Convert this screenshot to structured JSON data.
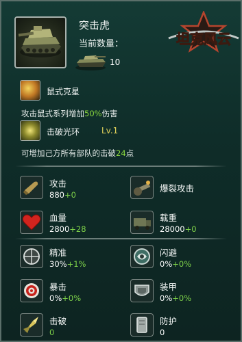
{
  "tank": {
    "name": "突击虎",
    "count_label": "当前数量：",
    "count": "10"
  },
  "logo": {
    "text": "坦克风云"
  },
  "skills": [
    {
      "name": "鼠式克星",
      "desc_prefix": "攻击鼠式系列增加",
      "desc_value": "50%",
      "desc_suffix": "伤害"
    },
    {
      "name": "击破光环",
      "level": "Lv.1",
      "desc_prefix": "可增加己方所有部队的击破",
      "desc_value": "24",
      "desc_suffix": "点"
    }
  ],
  "stats_primary": [
    {
      "label": "攻击",
      "base": "880",
      "bonus": "+0",
      "icon": "shell-icon"
    },
    {
      "label": "爆裂攻击",
      "base": "",
      "bonus": "",
      "icon": "cannon-icon"
    },
    {
      "label": "血量",
      "base": "2800",
      "bonus": "+28",
      "icon": "heart-icon"
    },
    {
      "label": "载重",
      "base": "28000",
      "bonus": "+0",
      "icon": "truck-icon"
    }
  ],
  "stats_secondary": [
    {
      "label": "精准",
      "base": "30%",
      "bonus": "+1%",
      "icon": "crosshair-icon"
    },
    {
      "label": "闪避",
      "base": "0%",
      "bonus": "+0%",
      "icon": "dodge-icon"
    },
    {
      "label": "暴击",
      "base": "0%",
      "bonus": "+0%",
      "icon": "target-icon"
    },
    {
      "label": "装甲",
      "base": "0%",
      "bonus": "+0%",
      "icon": "armor-icon"
    },
    {
      "label": "击破",
      "base": "0",
      "bonus": "",
      "icon": "breach-icon"
    },
    {
      "label": "防护",
      "base": "0",
      "bonus": "",
      "icon": "shield-plate-icon"
    }
  ],
  "colors": {
    "highlight": "#8bd83e",
    "level": "#e3d35a",
    "bg": "#143b35"
  }
}
